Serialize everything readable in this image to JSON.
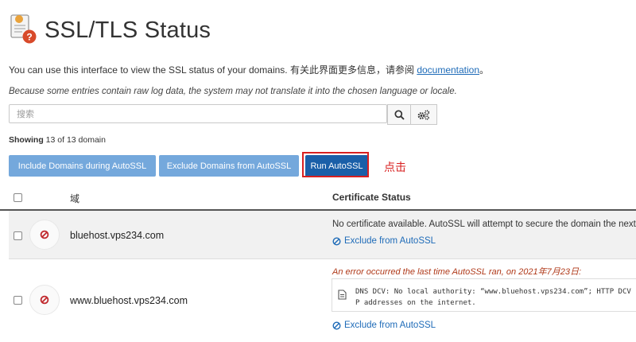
{
  "header": {
    "title": "SSL/TLS Status",
    "icon": "certificate-warning-icon"
  },
  "intro": {
    "text": "You can use this interface to view the SSL status of your domains. 有关此界面更多信息，请参阅 ",
    "link": "documentation",
    "suffix": "。"
  },
  "raw_note": "Because some entries contain raw log data, the system may not translate it into the chosen language or locale.",
  "search": {
    "placeholder": "搜索",
    "search_icon": "search-icon",
    "settings_icon": "gears-icon"
  },
  "showing": {
    "label": "Showing",
    "text": " 13 of 13 domain"
  },
  "buttons": {
    "include": "Include Domains during AutoSSL",
    "exclude": "Exclude Domains from AutoSSL",
    "run": "Run AutoSSL"
  },
  "annotation": "点击",
  "table": {
    "columns": [
      "域",
      "Certificate Status"
    ],
    "rows": [
      {
        "domain": "bluehost.vps234.com",
        "status": "No certificate available. AutoSSL will attempt to secure the domain the next",
        "action": "Exclude from AutoSSL"
      },
      {
        "domain": "www.bluehost.vps234.com",
        "error": "An error occurred the last time AutoSSL ran, on 2021年7月23日:",
        "log_line1": "DNS DCV: No local authority: “www.bluehost.vps234.com”; HTTP DCV",
        "log_line2": "P addresses on the internet.",
        "action": "Exclude from AutoSSL"
      }
    ]
  },
  "colors": {
    "button": "#74a8dc",
    "button_primary": "#1a5fa8",
    "link": "#1e6bb8",
    "error": "#b03a1a",
    "annotation": "#d82020"
  }
}
